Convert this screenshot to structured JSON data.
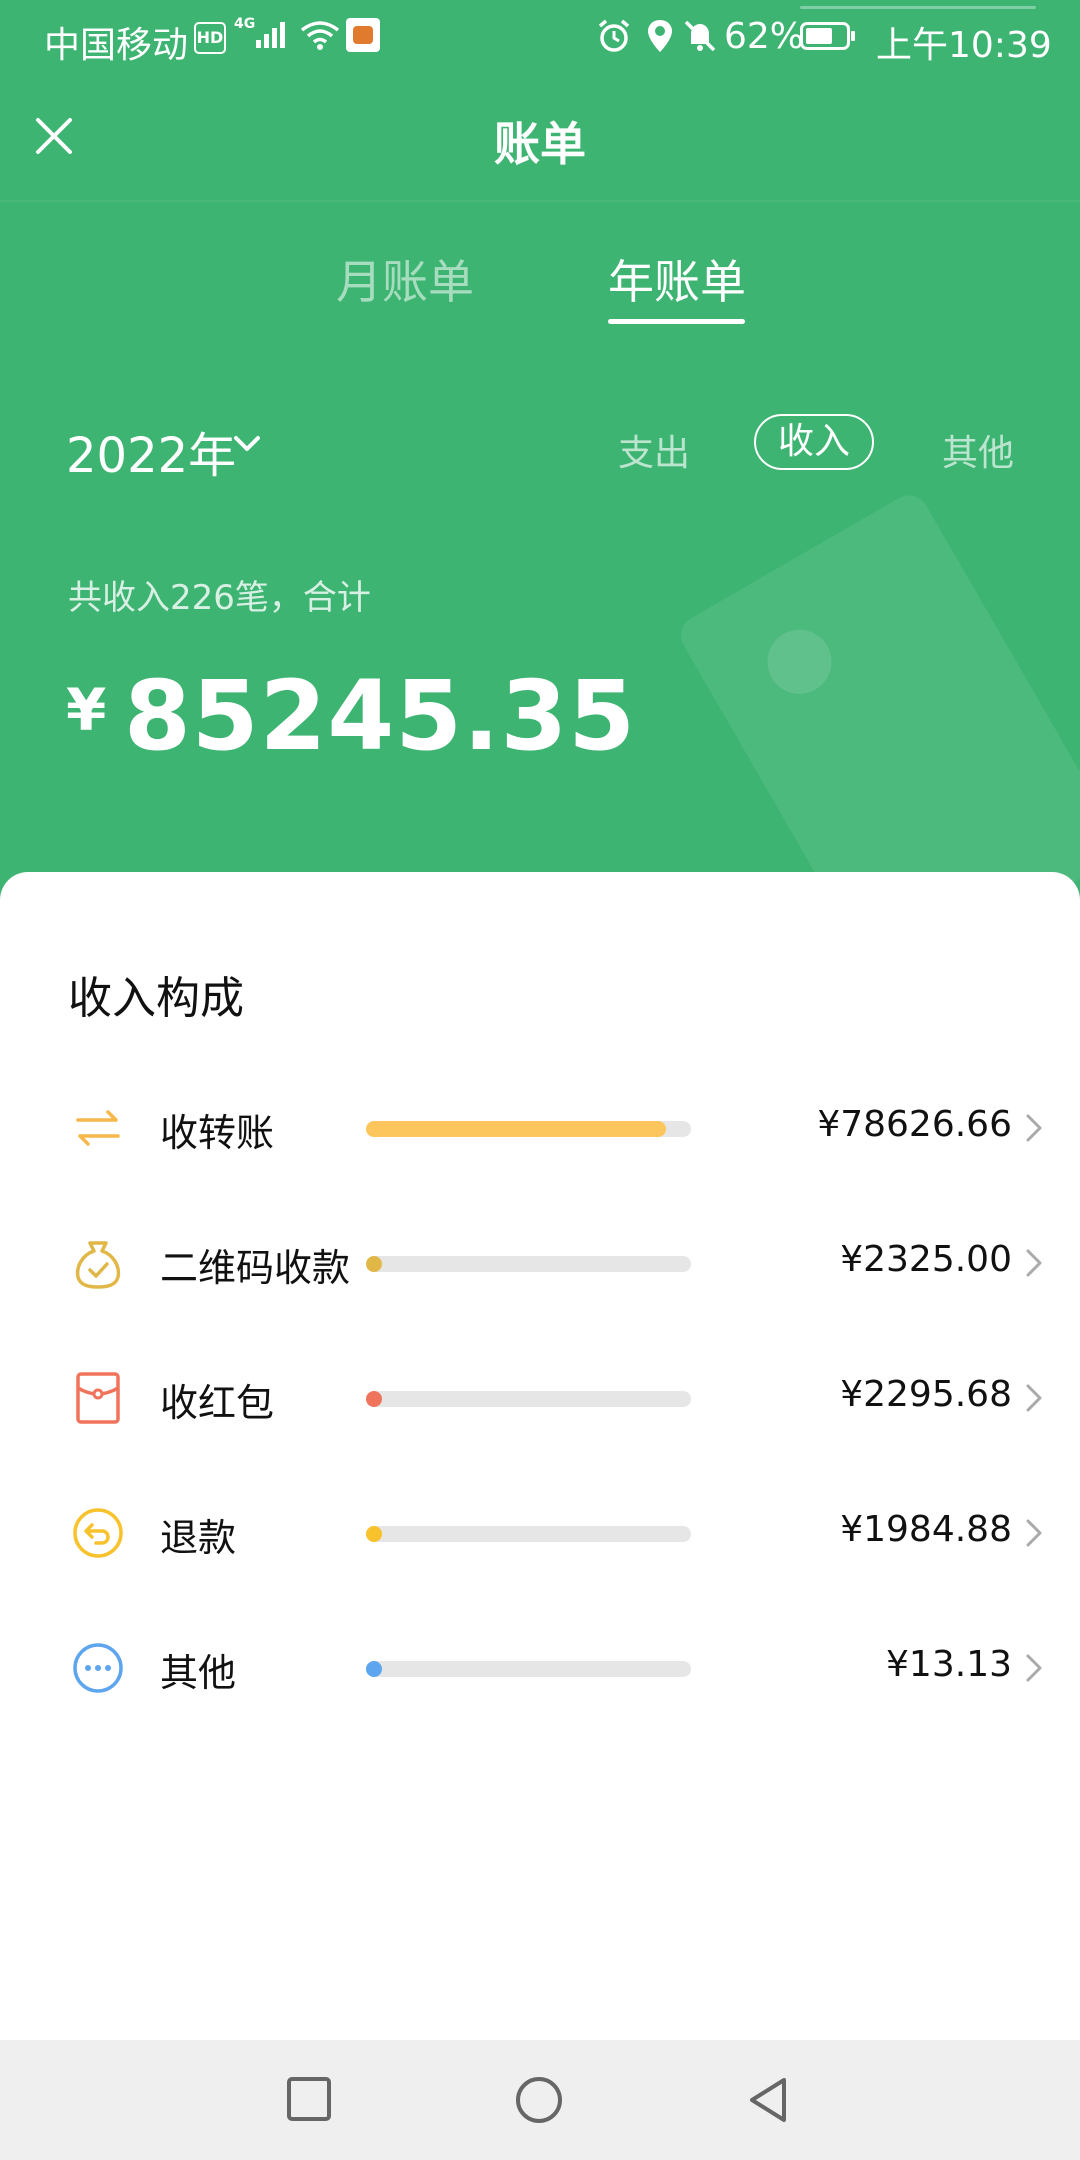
{
  "status_bar": {
    "carrier": "中国移动",
    "hd": "HD",
    "network": "4G",
    "battery_percent": "62%",
    "time": "上午10:39"
  },
  "header": {
    "title": "账单",
    "tabs": [
      {
        "label": "月账单",
        "active": false
      },
      {
        "label": "年账单",
        "active": true
      }
    ],
    "year_selector": "2022年",
    "filters": [
      {
        "label": "支出",
        "active": false
      },
      {
        "label": "收入",
        "active": true
      },
      {
        "label": "其他",
        "active": false
      }
    ],
    "summary": "共收入226笔，合计",
    "currency": "¥",
    "total": "85245.35"
  },
  "composition": {
    "title": "收入构成",
    "items": [
      {
        "label": "收转账",
        "amount": "¥78626.66",
        "share": 0.922,
        "color": "#fcc65c",
        "icon": "transfer-icon"
      },
      {
        "label": "二维码收款",
        "amount": "¥2325.00",
        "share": 0.027,
        "color": "#e1b748",
        "icon": "money-bag-icon"
      },
      {
        "label": "收红包",
        "amount": "¥2295.68",
        "share": 0.027,
        "color": "#f0745c",
        "icon": "red-envelope-icon"
      },
      {
        "label": "退款",
        "amount": "¥1984.88",
        "share": 0.023,
        "color": "#f7c22b",
        "icon": "refund-icon"
      },
      {
        "label": "其他",
        "amount": "¥13.13",
        "share": 0.0002,
        "color": "#5da5ee",
        "icon": "more-icon"
      }
    ]
  },
  "colors": {
    "header_bg": "#3db472",
    "accent_white": "#ffffff"
  }
}
